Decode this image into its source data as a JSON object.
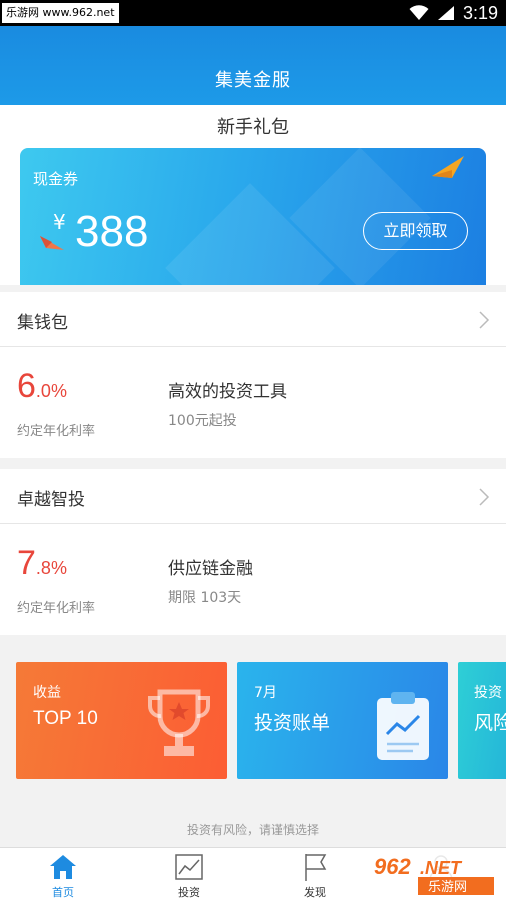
{
  "statusbar": {
    "watermark": "乐游网 www.962.net",
    "time": "3:19"
  },
  "header": {
    "title": "集美金服"
  },
  "gift": {
    "title": "新手礼包",
    "coupon_label": "现金券",
    "currency": "¥",
    "amount": "388",
    "claim_button": "立即领取"
  },
  "products": [
    {
      "name": "集钱包",
      "rate_int": "6",
      "rate_dec": ".0",
      "rate_unit": "%",
      "rate_label": "约定年化利率",
      "desc": "高效的投资工具",
      "sub": "100元起投"
    },
    {
      "name": "卓越智投",
      "rate_int": "7",
      "rate_dec": ".8",
      "rate_unit": "%",
      "rate_label": "约定年化利率",
      "desc": "供应链金融",
      "sub": "期限 103天"
    }
  ],
  "banners": [
    {
      "small": "收益",
      "big": "TOP 10",
      "color": "#fc5d34"
    },
    {
      "small": "7月",
      "big": "投资账单",
      "color": "#2a86e8"
    },
    {
      "small": "投资",
      "big": "风险",
      "color": "#23b2d9"
    }
  ],
  "risk_notice": "投资有风险，请谨慎选择",
  "tabs": [
    {
      "label": "首页",
      "icon": "home-icon"
    },
    {
      "label": "投资",
      "icon": "chart-icon"
    },
    {
      "label": "发现",
      "icon": "flag-icon"
    },
    {
      "label": "",
      "icon": "user-icon"
    }
  ],
  "watermark_logo": "962.NET 乐游网",
  "colors": {
    "primary": "#1e8be0",
    "rate_red": "#e8463b"
  }
}
